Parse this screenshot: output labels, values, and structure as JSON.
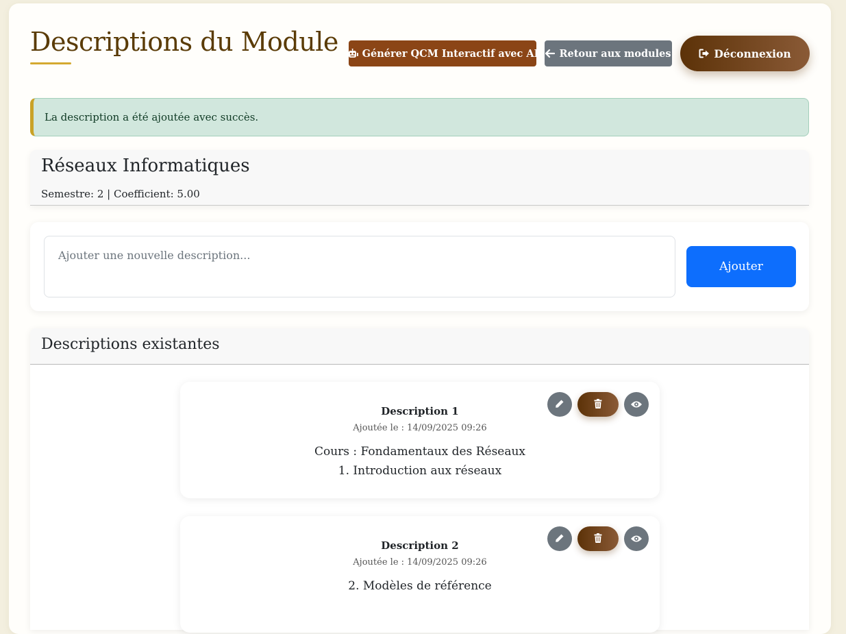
{
  "header": {
    "title": "Descriptions du Module",
    "qcm_button": "Générer QCM Interactif avec AI",
    "back_button": "Retour aux modules",
    "logout_button": "Déconnexion"
  },
  "alert": {
    "message": "La description a été ajoutée avec succès."
  },
  "module": {
    "name": "Réseaux Informatiques",
    "meta": "Semestre: 2 | Coefficient: 5.00"
  },
  "form": {
    "placeholder": "Ajouter une nouvelle description...",
    "value": "",
    "submit_label": "Ajouter"
  },
  "descriptions": {
    "heading": "Descriptions existantes",
    "items": [
      {
        "title": "Description 1",
        "date": "Ajoutée le : 14/09/2025 09:26",
        "line1": "Cours : Fondamentaux des Réseaux",
        "line2": "1. Introduction aux réseaux"
      },
      {
        "title": "Description 2",
        "date": "Ajoutée le : 14/09/2025 09:26",
        "line1": "2. Modèles de référence",
        "line2": ""
      }
    ]
  },
  "icons": {
    "qcm": "robot-icon",
    "back": "arrow-left-icon",
    "logout": "sign-out-icon",
    "edit": "pencil-icon",
    "delete": "trash-icon",
    "view": "eye-icon"
  },
  "colors": {
    "title": "#5a3b06",
    "accent_gold": "#d4a930",
    "qcm_button": "#8b4516",
    "secondary_button": "#6c757d",
    "primary_button": "#0d6efd",
    "alert_background": "#d1e7dd",
    "logout_gradient_start": "#5c3208",
    "logout_gradient_end": "#8a5a36"
  }
}
